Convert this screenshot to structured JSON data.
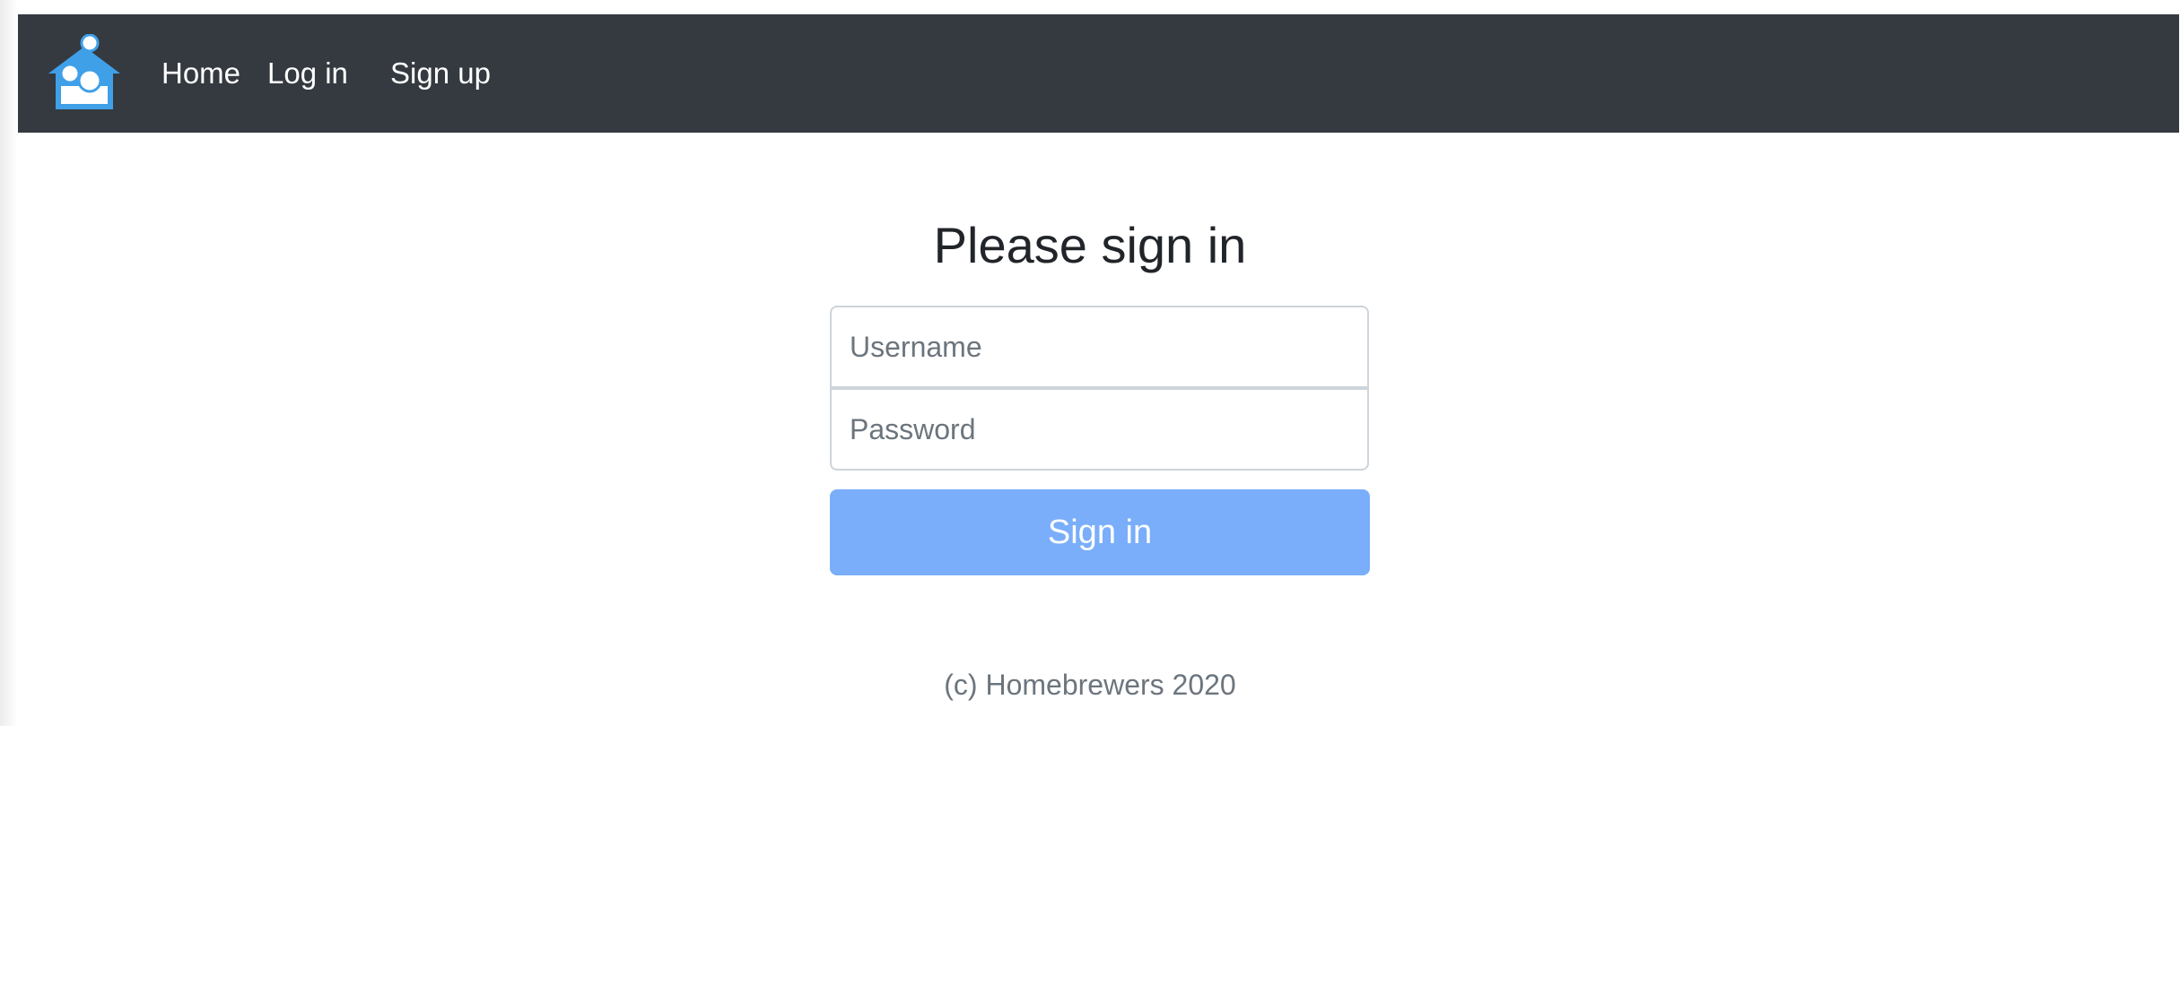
{
  "navbar": {
    "logo_icon": "family-house-logo-icon",
    "links": {
      "home": "Home",
      "login": "Log in",
      "signup": "Sign up"
    },
    "background_color": "#343a40"
  },
  "form": {
    "title": "Please sign in",
    "username": {
      "placeholder": "Username",
      "value": ""
    },
    "password": {
      "placeholder": "Password",
      "value": ""
    },
    "submit_label": "Sign in",
    "submit_color": "#7aaefa"
  },
  "footer": {
    "text": "(c) Homebrewers 2020"
  }
}
